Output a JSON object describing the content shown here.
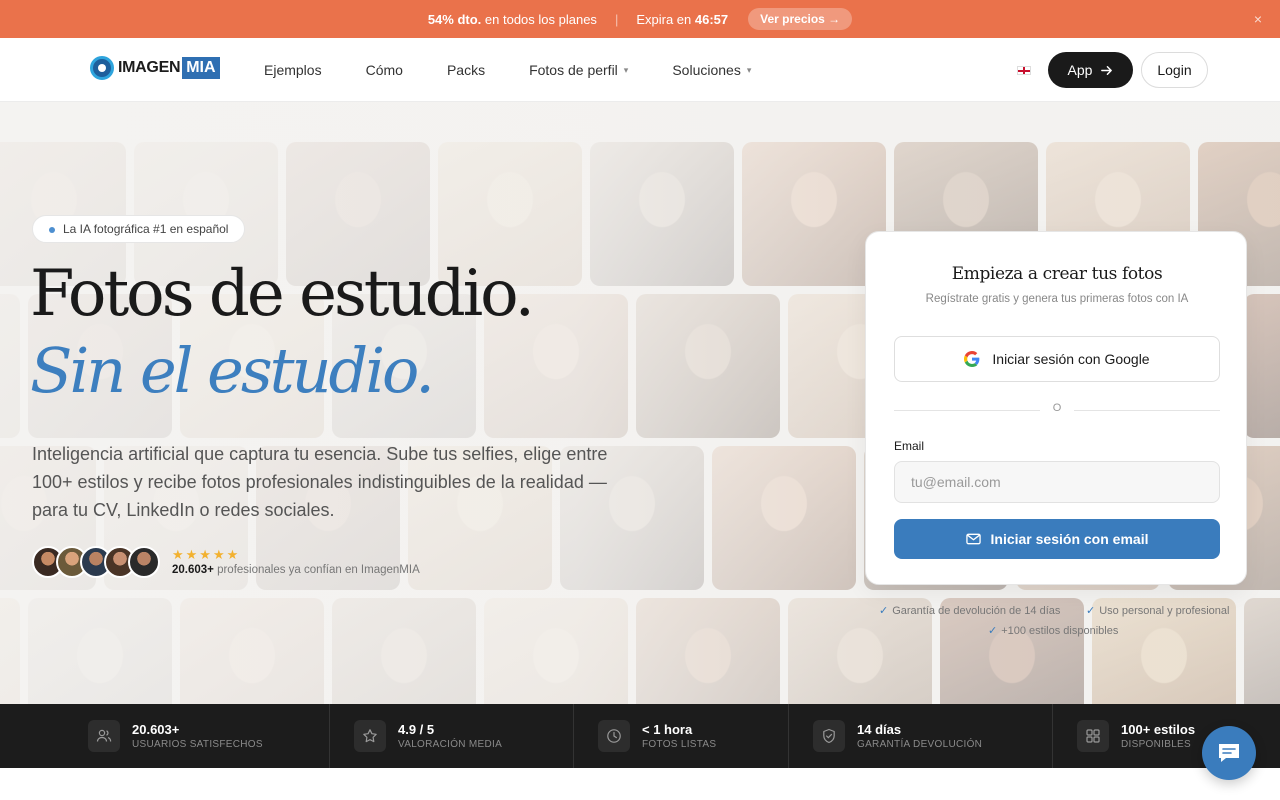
{
  "promo": {
    "discount": "54% dto.",
    "discount_rest": " en todos los planes",
    "separator": "|",
    "expires_label": "Expira en ",
    "expires_time": "46:57",
    "cta": "Ver precios →",
    "close": "×"
  },
  "nav": {
    "logo_text": "IMAGEN",
    "logo_mia": "MIA",
    "links": [
      {
        "label": "Ejemplos"
      },
      {
        "label": "Cómo"
      },
      {
        "label": "Packs"
      },
      {
        "label": "Fotos de perfil",
        "dropdown": true
      },
      {
        "label": "Soluciones",
        "dropdown": true
      }
    ],
    "app_label": "App",
    "login_label": "Login"
  },
  "hero": {
    "badge": "La IA fotográfica #1 en español",
    "title": "Fotos de estudio.",
    "title_accent": "Sin el estudio.",
    "lead": "Inteligencia artificial que captura tu esencia. Sube tus selfies, elige entre 100+ estilos y recibe fotos profesionales indistinguibles de la realidad — para tu CV, LinkedIn o redes sociales.",
    "stars": "★★★★★",
    "social_count": "20.603+",
    "social_text": " profesionales ya confían en ImagenMIA"
  },
  "signup": {
    "title": "Empieza a crear tus fotos",
    "subtitle": "Regístrate gratis y genera tus primeras fotos con IA",
    "google_label": "Iniciar sesión con Google",
    "divider": "O",
    "email_label": "Email",
    "email_placeholder": "tu@email.com",
    "email_value": "",
    "email_button": "Iniciar sesión con email"
  },
  "guarantees": [
    "Garantía de devolución de 14 días",
    "Uso personal y profesional",
    "+100 estilos disponibles"
  ],
  "stats": [
    {
      "value": "20.603+",
      "label": "USUARIOS SATISFECHOS",
      "icon": "users-icon"
    },
    {
      "value": "4.9 / 5",
      "label": "VALORACIÓN MEDIA",
      "icon": "star-icon"
    },
    {
      "value": "< 1 hora",
      "label": "FOTOS LISTAS",
      "icon": "clock-icon"
    },
    {
      "value": "14 días",
      "label": "GARANTÍA DEVOLUCIÓN",
      "icon": "shield-check-icon"
    },
    {
      "value": "100+ estilos",
      "label": "DISPONIBLES",
      "icon": "grid-icon"
    }
  ],
  "colors": {
    "promo": "#ea724b",
    "accent": "#3a7cbd",
    "dark": "#1c1c1c",
    "star": "#f2b12f"
  }
}
